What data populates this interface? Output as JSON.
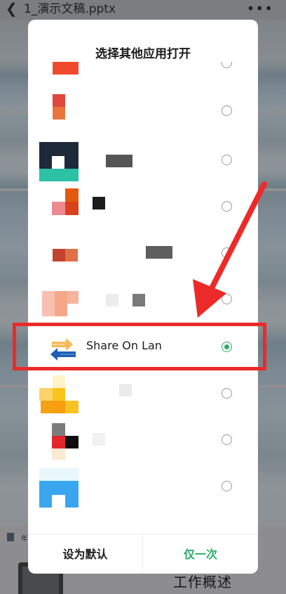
{
  "header": {
    "back_icon": "chevron-left-icon",
    "file_title": "1_演示文稿.pptx",
    "more_icon": "more-icon"
  },
  "background": {
    "doc_label": "年",
    "heading": "工作概述"
  },
  "dialog": {
    "title": "选择其他应用打开",
    "apps": [
      {
        "label": "",
        "selected": false
      },
      {
        "label": "",
        "selected": false
      },
      {
        "label": "",
        "selected": false
      },
      {
        "label": "",
        "selected": false
      },
      {
        "label": "",
        "selected": false
      },
      {
        "label": "",
        "selected": false
      },
      {
        "label": "Share On Lan",
        "selected": true
      },
      {
        "label": "",
        "selected": false
      },
      {
        "label": "",
        "selected": false
      },
      {
        "label": "",
        "selected": false
      }
    ],
    "buttons": {
      "set_default": "设为默认",
      "just_once": "仅一次"
    }
  },
  "colors": {
    "accent": "#2aae67",
    "annotation": "#ec2a2a"
  }
}
